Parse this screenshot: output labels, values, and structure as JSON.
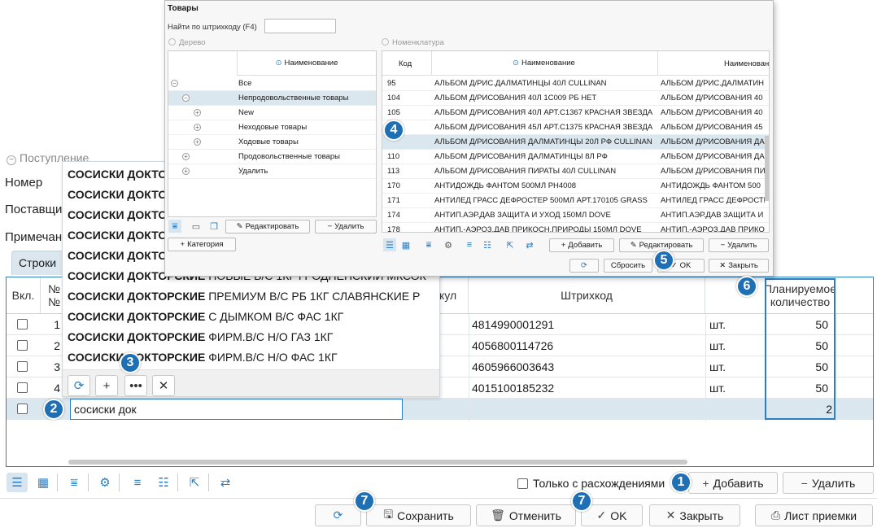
{
  "form": {
    "group_title": "Поступление",
    "label_number": "Номер",
    "label_supplier": "Поставщик",
    "label_note": "Примечание",
    "tab_rows": "Строки"
  },
  "grid": {
    "headers": {
      "incl": "Вкл.",
      "num": "№\n№",
      "article": "кул",
      "barcode": "Штрихкод",
      "planned": "Планируемое количество"
    },
    "rows": [
      {
        "num": "1",
        "barcode": "4814990001291",
        "unit": "шт.",
        "qty": "50"
      },
      {
        "num": "2",
        "barcode": "4056800114726",
        "unit": "шт.",
        "qty": "50"
      },
      {
        "num": "3",
        "barcode": "4605966003643",
        "unit": "шт.",
        "qty": "50"
      },
      {
        "num": "4",
        "barcode": "4015100185232",
        "unit": "шт.",
        "qty": "50"
      }
    ],
    "edit_row": {
      "search_value": "сосиски док",
      "qty": "2"
    }
  },
  "dropdown": {
    "items": [
      {
        "bold": "СОСИСКИ ДОКТОРСКИЕ",
        "rest": ""
      },
      {
        "bold": "СОСИСКИ ДОКТОРСКИЕ",
        "rest": ""
      },
      {
        "bold": "СОСИСКИ ДОКТОРСКИЕ",
        "rest": ""
      },
      {
        "bold": "СОСИСКИ ДОКТОРСКИЕ",
        "rest": ""
      },
      {
        "bold": "СОСИСКИ ДОКТОРСКИЕ",
        "rest": ""
      },
      {
        "bold": "СОСИСКИ ДОКТОРСКИЕ",
        "rest": " НОВЫЕ В/С 1КГ ГРОДНЕНСКИЙ МКСОК"
      },
      {
        "bold": "СОСИСКИ ДОКТОРСКИЕ",
        "rest": " ПРЕМИУМ В/С РБ 1КГ СЛАВЯНСКИЕ Р"
      },
      {
        "bold": "СОСИСКИ ДОКТОРСКИЕ",
        "rest": " С ДЫМКОМ В/С ФАС 1КГ"
      },
      {
        "bold": "СОСИСКИ ДОКТОРСКИЕ",
        "rest": " ФИРМ.В/С Н/О ГАЗ 1КГ"
      },
      {
        "bold": "СОСИСКИ ДОКТОРСКИЕ",
        "rest": " ФИРМ.В/С Н/О ФАС 1КГ"
      }
    ]
  },
  "modal": {
    "title": "Товары",
    "barcode_label": "Найти по штрихкоду (F4)",
    "tree_group": "Дерево",
    "nom_group": "Номенклатура",
    "tree_header": "Наименование",
    "tree": [
      {
        "label": "Все",
        "level": 0,
        "exp": "−"
      },
      {
        "label": "Непродовольственные товары",
        "level": 1,
        "exp": "−",
        "selected": true
      },
      {
        "label": "New",
        "level": 2,
        "exp": "+"
      },
      {
        "label": "Неходовые товары",
        "level": 2,
        "exp": "+"
      },
      {
        "label": "Ходовые товары",
        "level": 2,
        "exp": "+"
      },
      {
        "label": "Продовольственные товары",
        "level": 1,
        "exp": "+"
      },
      {
        "label": "Удалить",
        "level": 1,
        "exp": "+"
      }
    ],
    "tree_edit": "Редактировать",
    "tree_delete": "Удалить",
    "tree_category": "Категория",
    "nom_headers": {
      "code": "Код",
      "name": "Наименование",
      "name2": "Наименован"
    },
    "nom_rows": [
      {
        "code": "95",
        "name": "АЛЬБОМ Д/РИС.ДАЛМАТИНЦЫ 40Л CULLINAN",
        "name2": "АЛЬБОМ Д/РИС.ДАЛМАТИН"
      },
      {
        "code": "104",
        "name": "АЛЬБОМ Д/РИСОВАНИЯ 40Л 1С009 РБ НЕТ",
        "name2": "АЛЬБОМ Д/РИСОВАНИЯ 40"
      },
      {
        "code": "105",
        "name": "АЛЬБОМ Д/РИСОВАНИЯ 40Л АРТ.С1367 КРАСНАЯ ЗВЕЗДА",
        "name2": "АЛЬБОМ Д/РИСОВАНИЯ 40"
      },
      {
        "code": "107",
        "name": "АЛЬБОМ Д/РИСОВАНИЯ 45Л АРТ.С1375 КРАСНАЯ ЗВЕЗДА",
        "name2": "АЛЬБОМ Д/РИСОВАНИЯ 45"
      },
      {
        "code": "",
        "name": "АЛЬБОМ Д/РИСОВАНИЯ ДАЛМАТИНЦЫ 20Л РФ CULLINAN",
        "name2": "АЛЬБОМ Д/РИСОВАНИЯ ДА",
        "selected": true
      },
      {
        "code": "110",
        "name": "АЛЬБОМ Д/РИСОВАНИЯ ДАЛМАТИНЦЫ 8Л РФ",
        "name2": "АЛЬБОМ Д/РИСОВАНИЯ ДА"
      },
      {
        "code": "113",
        "name": "АЛЬБОМ Д/РИСОВАНИЯ ПИРАТЫ 40Л CULLINAN",
        "name2": "АЛЬБОМ Д/РИСОВАНИЯ ПИ"
      },
      {
        "code": "170",
        "name": "АНТИДОЖДЬ ФАНТОМ 500МЛ РН4008",
        "name2": "АНТИДОЖДЬ ФАНТОМ 500"
      },
      {
        "code": "171",
        "name": "АНТИЛЕД ГРАСС ДЕФРОСТЕР 500МЛ АРТ.170105 GRASS",
        "name2": "АНТИЛЕД ГРАСС ДЕФРОСТЕ"
      },
      {
        "code": "174",
        "name": "АНТИП.АЭР.ДАВ ЗАЩИТА И УХОД 150МЛ DOVE",
        "name2": "АНТИП.АЭР.ДАВ ЗАЩИТА И"
      },
      {
        "code": "178",
        "name": "АНТИП.-АЭРОЗ.ДАВ ПРИКОСН.ПРИРОДЫ 150МЛ DOVE",
        "name2": "АНТИП.-АЭРОЗ.ДАВ ПРИКОС"
      }
    ],
    "nom_add": "Добавить",
    "nom_edit": "Редактировать",
    "nom_delete": "Удалить",
    "reset": "Сбросить",
    "ok": "OK",
    "close": "Закрыть"
  },
  "bottom": {
    "only_diff": "Только с расхождениями",
    "add": "Добавить",
    "delete": "Удалить",
    "save": "Сохранить",
    "cancel": "Отменить",
    "ok": "OK",
    "close": "Закрыть",
    "receipt": "Лист приемки"
  },
  "badges": [
    "1",
    "2",
    "3",
    "4",
    "5",
    "6",
    "7",
    "7"
  ],
  "colors": {
    "accent": "#2a7fc4",
    "badge": "#1f6fb5",
    "selected_row": "#dbe7ef"
  }
}
